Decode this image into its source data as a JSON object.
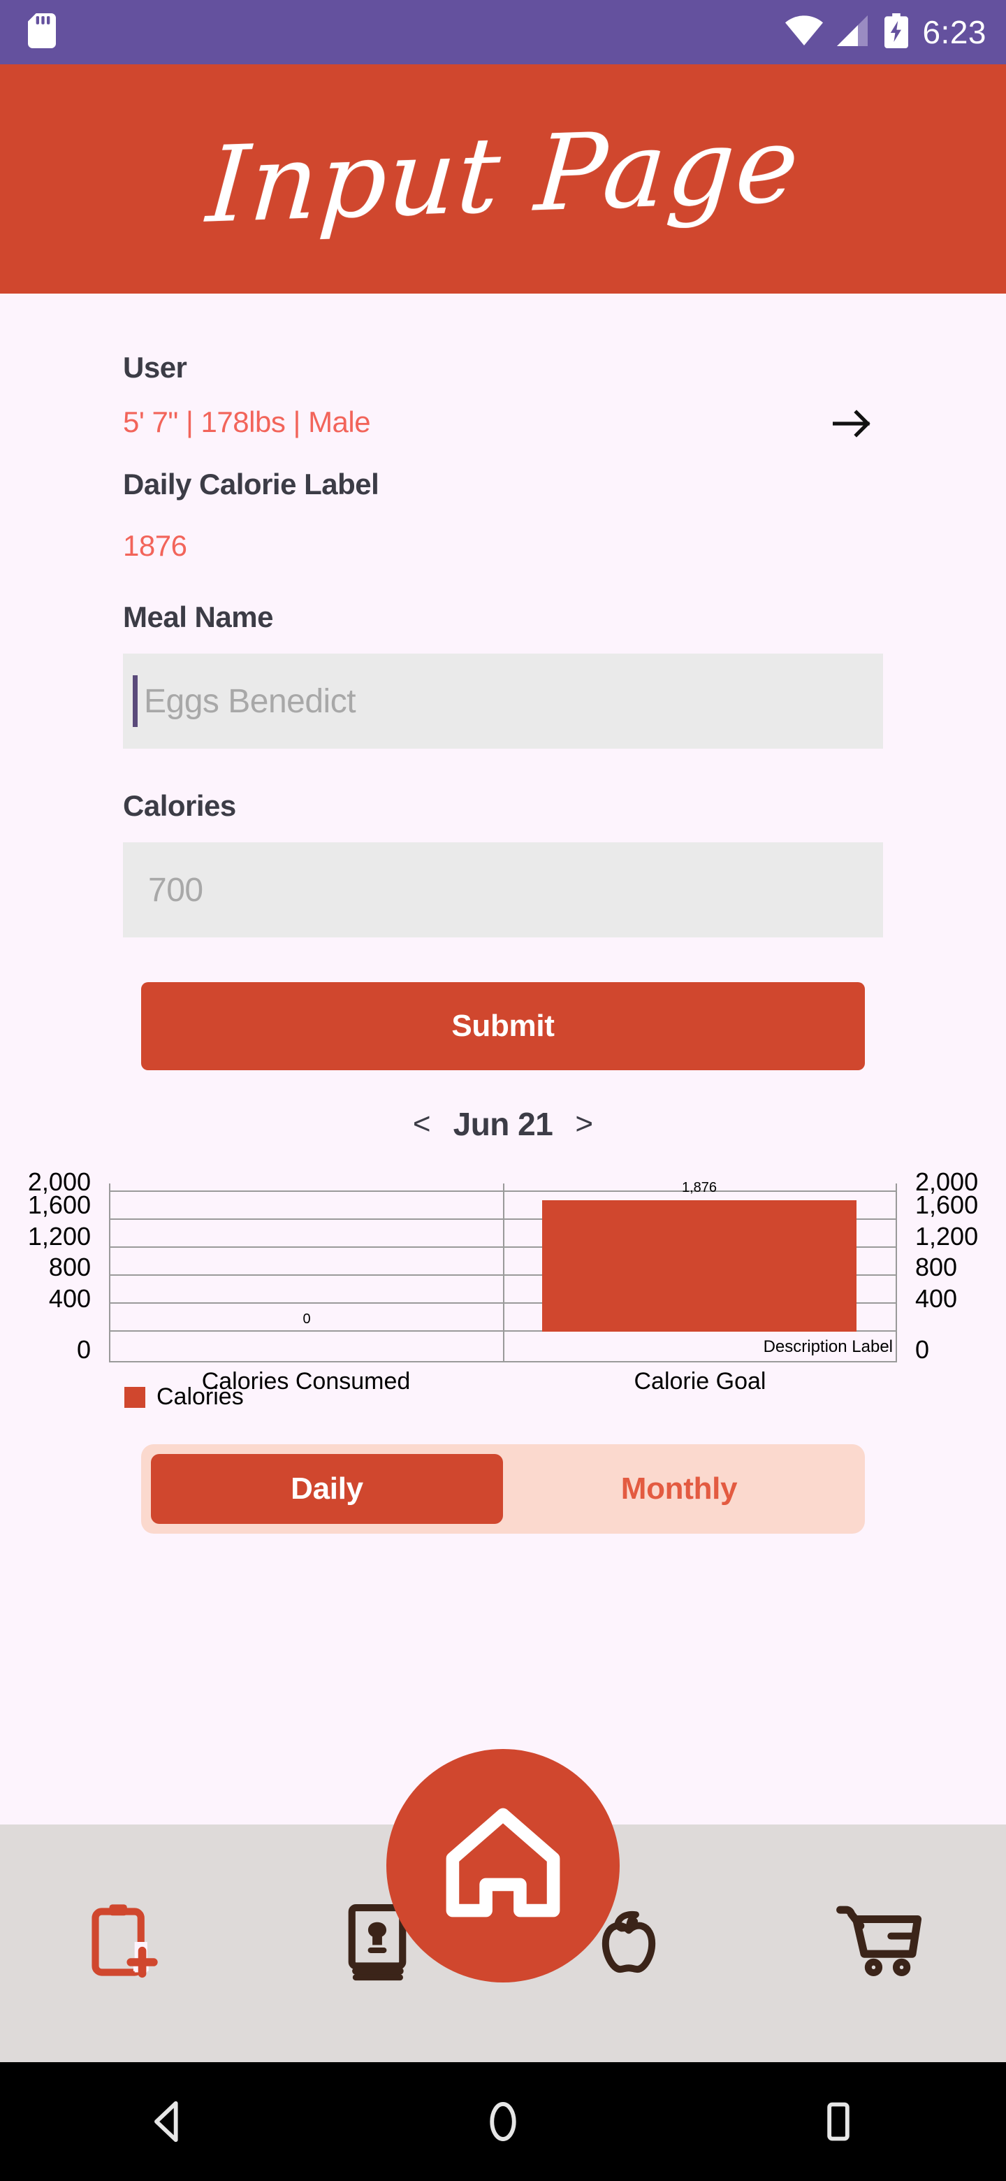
{
  "status_bar": {
    "time": "6:23",
    "icons": [
      "sd-card-icon",
      "wifi-icon",
      "cellular-signal-icon",
      "battery-charging-icon"
    ],
    "background_color": "#64519E"
  },
  "header": {
    "title": "Input Page",
    "background_color": "#D0472E"
  },
  "form": {
    "user_label": "User",
    "user_value": "5' 7\" | 178lbs | Male",
    "user_arrow_icon": "arrow-right-icon",
    "daily_calorie_label": "Daily Calorie Label",
    "daily_calorie_value": "1876",
    "meal_name_label": "Meal Name",
    "meal_name_placeholder": "Eggs Benedict",
    "meal_name_value": "",
    "calories_label": "Calories",
    "calories_placeholder": "700",
    "calories_value": "",
    "submit_label": "Submit"
  },
  "date_nav": {
    "prev": "<",
    "date": "Jun 21",
    "next": ">"
  },
  "chart_data": {
    "type": "bar",
    "categories": [
      "Calories Consumed",
      "Calorie Goal"
    ],
    "values": [
      0,
      1876
    ],
    "data_labels": [
      "0",
      "1,876"
    ],
    "title": "",
    "xlabel": "",
    "ylabel": "",
    "ylim": [
      0,
      2000
    ],
    "y_ticks": [
      "2,000",
      "1,600",
      "1,200",
      "800",
      "400",
      "0"
    ],
    "y_tick_values": [
      2000,
      1600,
      1200,
      800,
      400,
      0
    ],
    "dual_axis": true,
    "grid": true,
    "legend": {
      "position": "bottom-left",
      "entries": [
        {
          "name": "Calories",
          "color": "#D0472E"
        }
      ]
    },
    "annotation": "Description Label",
    "bar_color": "#D0472E"
  },
  "toggle": {
    "options": [
      "Daily",
      "Monthly"
    ],
    "selected": "Daily",
    "active_color": "#D0472E",
    "track_color": "#FBD9CE"
  },
  "bottom_nav": {
    "items": [
      {
        "icon": "clipboard-add-icon",
        "color": "#D0472E"
      },
      {
        "icon": "recipe-book-icon",
        "color": "#3B2419"
      },
      {
        "icon": "apple-icon",
        "color": "#3B2419"
      },
      {
        "icon": "shopping-cart-icon",
        "color": "#3B2419"
      }
    ],
    "fab": {
      "icon": "home-icon",
      "color": "#D0472E"
    },
    "background_color": "#DEDAD9"
  },
  "android_nav": {
    "buttons": [
      "back-icon",
      "home-circle-icon",
      "recents-square-icon"
    ],
    "background_color": "#000000"
  }
}
